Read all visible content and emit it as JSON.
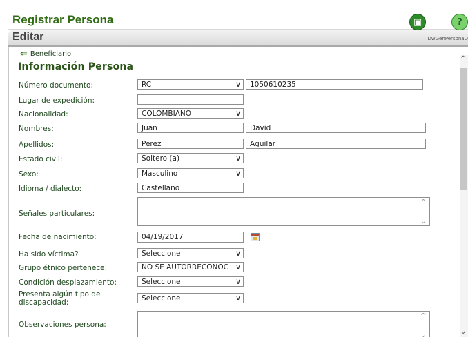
{
  "header": {
    "title": "Registrar Persona",
    "save_icon": "floppy-disk-icon",
    "help_icon": "question-icon",
    "save_glyph": "▣",
    "help_glyph": "?"
  },
  "editbar": {
    "label": "Editar",
    "window_name": "DwGenPersonaD"
  },
  "back_link": {
    "icon": "back-arrow-icon",
    "arrow_glyph": "⇐",
    "label": "Beneficiario"
  },
  "section_title": "Información Persona",
  "form": {
    "numero_documento": {
      "label": "Número documento:",
      "type_value": "RC",
      "number_value": "1050610235"
    },
    "lugar_expedicion": {
      "label": "Lugar de expedición:",
      "value": ""
    },
    "nacionalidad": {
      "label": "Nacionalidad:",
      "value": "COLOMBIANO"
    },
    "nombres": {
      "label": "Nombres:",
      "first": "Juan",
      "second": "David"
    },
    "apellidos": {
      "label": "Apellidos:",
      "first": "Perez",
      "second": "Aguilar"
    },
    "estado_civil": {
      "label": "Estado civil:",
      "value": "Soltero (a)"
    },
    "sexo": {
      "label": "Sexo:",
      "value": "Masculino"
    },
    "idioma": {
      "label": "Idioma / dialecto:",
      "value": "Castellano"
    },
    "senales": {
      "label": "Señales particulares:",
      "value": ""
    },
    "fecha_nacimiento": {
      "label": "Fecha de nacimiento:",
      "value": "04/19/2017",
      "icon": "calendar-icon"
    },
    "victima": {
      "label": "Ha sido víctima?",
      "value": "Seleccione"
    },
    "grupo_etnico": {
      "label": "Grupo étnico pertenece:",
      "value": "NO SE AUTORRECONOC"
    },
    "desplazamiento": {
      "label": "Condición desplazamiento:",
      "value": "Seleccione"
    },
    "discapacidad": {
      "label": "Presenta algún tipo de discapacidad:",
      "value": "Seleccione"
    },
    "observaciones": {
      "label": "Observaciones persona:",
      "value": ""
    }
  },
  "glyphs": {
    "chevron": "∨",
    "scroll_up": "^",
    "scroll_down": "⌄"
  },
  "colors": {
    "title_green": "#2f6b12",
    "label_green": "#214a21"
  }
}
